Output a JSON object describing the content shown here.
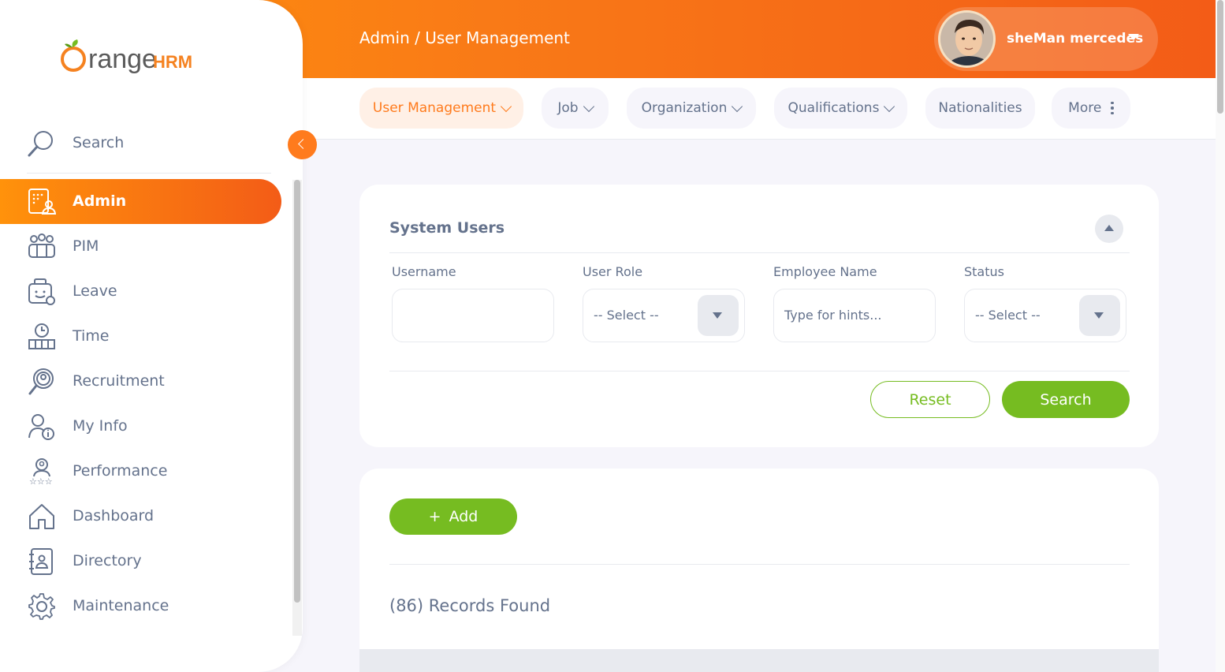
{
  "header": {
    "breadcrumb": "Admin / User Management",
    "user_name": "sheMan mercedes"
  },
  "brand": {
    "logo_text_main": "range",
    "logo_text_hrm": "HRM",
    "primary_color": "#ff7b1d",
    "success_color": "#76bc21",
    "text_color": "#64728c"
  },
  "sidebar": {
    "search_label": "Search",
    "items": [
      {
        "label": "Admin",
        "icon": "admin-icon",
        "active": true
      },
      {
        "label": "PIM",
        "icon": "pim-icon",
        "active": false
      },
      {
        "label": "Leave",
        "icon": "leave-icon",
        "active": false
      },
      {
        "label": "Time",
        "icon": "time-icon",
        "active": false
      },
      {
        "label": "Recruitment",
        "icon": "recruitment-icon",
        "active": false
      },
      {
        "label": "My Info",
        "icon": "my-info-icon",
        "active": false
      },
      {
        "label": "Performance",
        "icon": "performance-icon",
        "active": false
      },
      {
        "label": "Dashboard",
        "icon": "dashboard-icon",
        "active": false
      },
      {
        "label": "Directory",
        "icon": "directory-icon",
        "active": false
      },
      {
        "label": "Maintenance",
        "icon": "maintenance-icon",
        "active": false
      }
    ]
  },
  "tabs": [
    {
      "label": "User Management",
      "has_dropdown": true,
      "active": true
    },
    {
      "label": "Job",
      "has_dropdown": true,
      "active": false
    },
    {
      "label": "Organization",
      "has_dropdown": true,
      "active": false
    },
    {
      "label": "Qualifications",
      "has_dropdown": true,
      "active": false
    },
    {
      "label": "Nationalities",
      "has_dropdown": false,
      "active": false
    },
    {
      "label": "More",
      "has_dropdown": false,
      "active": false
    }
  ],
  "filter": {
    "title": "System Users",
    "username_label": "Username",
    "username_value": "",
    "user_role_label": "User Role",
    "user_role_value": "-- Select --",
    "employee_name_label": "Employee Name",
    "employee_name_placeholder": "Type for hints...",
    "status_label": "Status",
    "status_value": "-- Select --",
    "reset_label": "Reset",
    "search_label": "Search"
  },
  "results": {
    "add_label": "Add",
    "add_symbol": "+",
    "records_found": "(86) Records Found"
  }
}
